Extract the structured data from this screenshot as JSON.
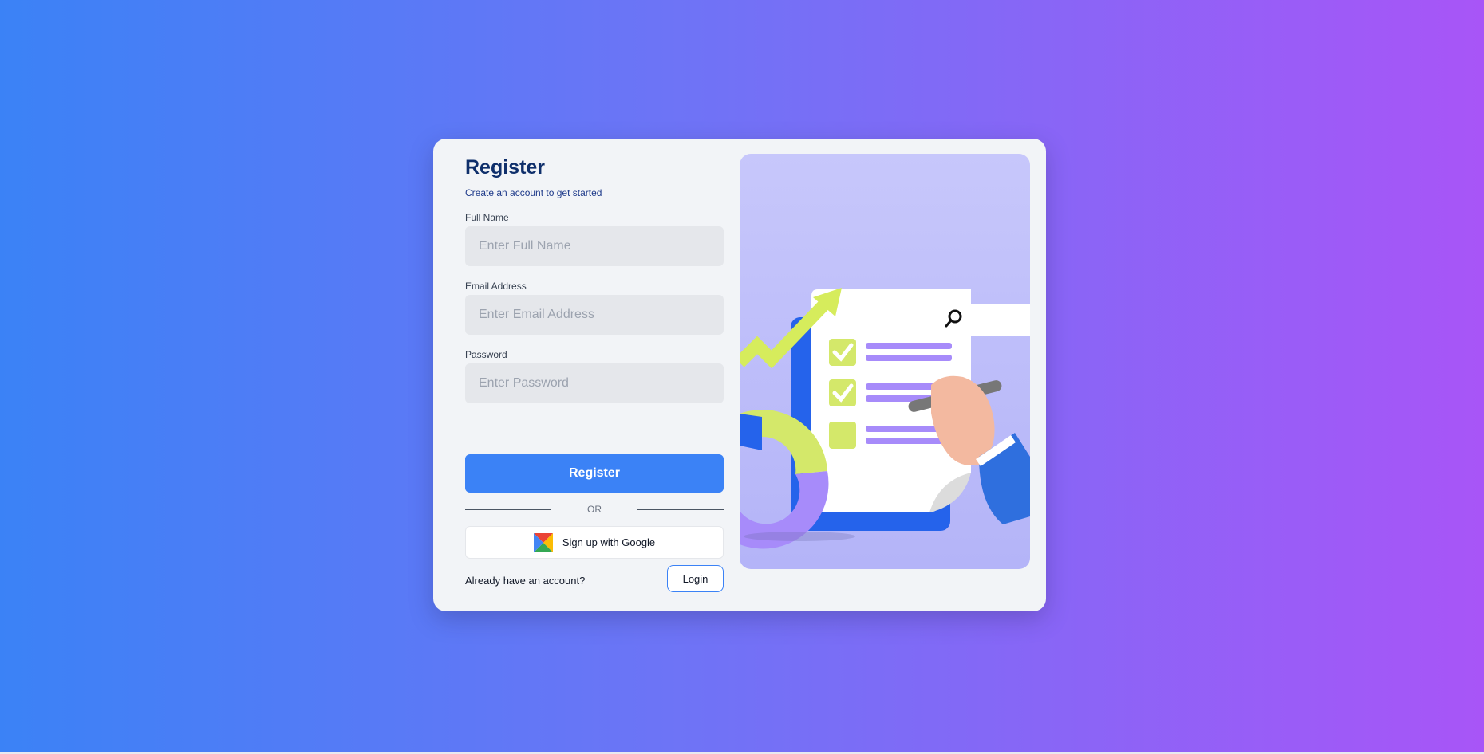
{
  "form": {
    "title": "Register",
    "subtitle": "Create an account to get started",
    "fields": [
      {
        "label": "Full Name",
        "placeholder": "Enter Full Name",
        "value": ""
      },
      {
        "label": "Email Address",
        "placeholder": "Enter Email Address",
        "value": ""
      },
      {
        "label": "Password",
        "placeholder": "Enter Password",
        "value": ""
      }
    ],
    "submit_label": "Register",
    "divider_text": "OR",
    "google_label": "Sign up with Google",
    "footer_text": "Already have an account?",
    "login_label": "Login"
  },
  "colors": {
    "primary": "#3b82f6",
    "title": "#0f2f6b",
    "bg_gradient_start": "#3b82f6",
    "bg_gradient_end": "#a855f7",
    "illustration_bg": "#c7c7fb"
  },
  "icons": {
    "google": "google-logo-icon",
    "search": "search-icon",
    "check": "check-icon"
  }
}
